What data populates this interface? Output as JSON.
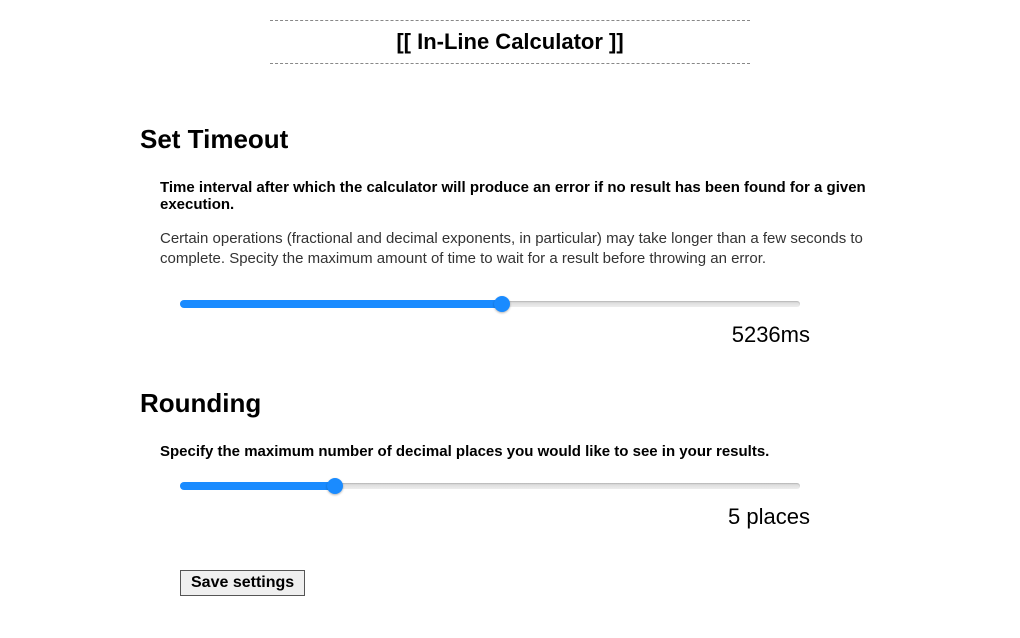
{
  "title": "[[ In-Line Calculator ]]",
  "sections": {
    "timeout": {
      "heading": "Set Timeout",
      "subtitle": "Time interval after which the calculator will produce an error if no result has been found for a given execution.",
      "description": "Certain operations (fractional and decimal exponents, in particular) may take longer than a few seconds to complete. Specity the maximum amount of time to wait for a result before throwing an error.",
      "value_label": "5236ms",
      "slider_percent": 52
    },
    "rounding": {
      "heading": "Rounding",
      "subtitle": "Specify the maximum number of decimal places you would like to see in your results.",
      "value_label": "5 places",
      "slider_percent": 25
    }
  },
  "buttons": {
    "save": "Save settings"
  }
}
